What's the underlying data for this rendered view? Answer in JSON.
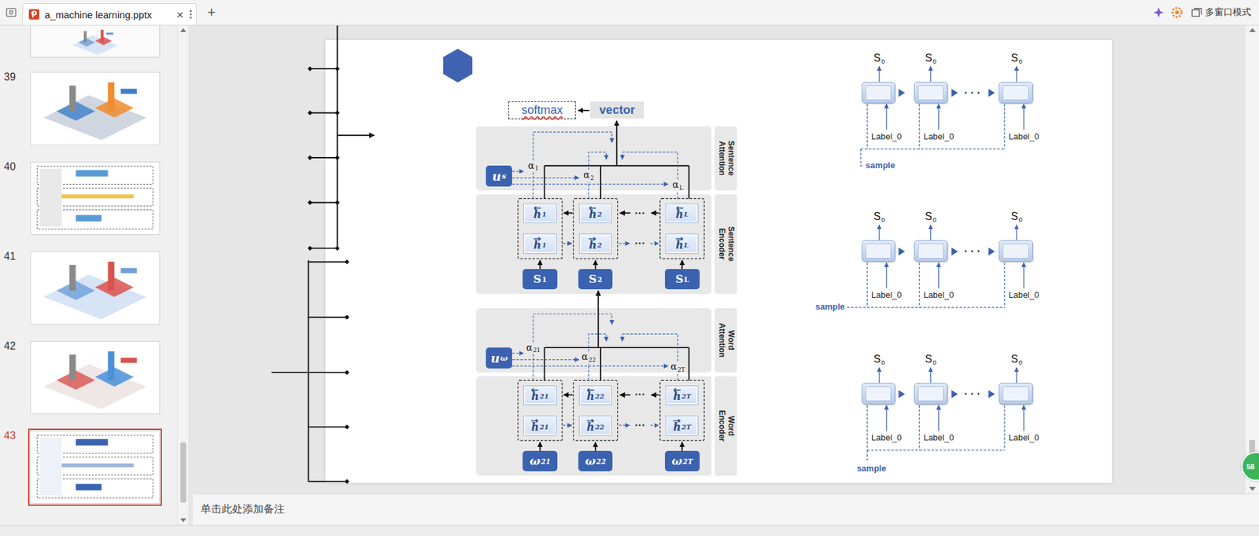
{
  "app": {
    "tab_title": "a_machine learning.pptx",
    "tab_close": "×",
    "new_tab": "+",
    "multi_window": "多窗口模式",
    "page_badge": "58"
  },
  "thumbnails": [
    {
      "number": "39",
      "selected": false
    },
    {
      "number": "40",
      "selected": false
    },
    {
      "number": "41",
      "selected": false
    },
    {
      "number": "42",
      "selected": false
    },
    {
      "number": "43",
      "selected": true
    }
  ],
  "notes": {
    "placeholder": "单击此处添加备注"
  },
  "han": {
    "softmax": {
      "text": "softmax",
      "misspelled": true
    },
    "vector": "vector",
    "levels": [
      {
        "attention_label": "Sentence Attention",
        "encoder_label": "Sentence Encoder",
        "context": {
          "base": "u",
          "sub": "s"
        },
        "ellipsis": "···",
        "alphas": [
          {
            "base": "α",
            "sub": "1"
          },
          {
            "base": "α",
            "sub": "2"
          },
          {
            "base": "α",
            "sub": "L"
          }
        ],
        "cells": [
          {
            "backward": {
              "base": "h",
              "sub": "1"
            },
            "forward": {
              "base": "h",
              "sub": "1"
            },
            "input": {
              "base": "S",
              "sub": "1"
            }
          },
          {
            "backward": {
              "base": "h",
              "sub": "2"
            },
            "forward": {
              "base": "h",
              "sub": "2"
            },
            "input": {
              "base": "S",
              "sub": "2"
            }
          },
          {
            "backward": {
              "base": "h",
              "sub": "L"
            },
            "forward": {
              "base": "h",
              "sub": "L"
            },
            "input": {
              "base": "S",
              "sub": "L"
            }
          }
        ]
      },
      {
        "attention_label": "Word Attention",
        "encoder_label": "Word Encoder",
        "context": {
          "base": "u",
          "sub": "ω"
        },
        "ellipsis": "···",
        "alphas": [
          {
            "base": "α",
            "sub": "21"
          },
          {
            "base": "α",
            "sub": "22"
          },
          {
            "base": "α",
            "sub": "2T"
          }
        ],
        "cells": [
          {
            "backward": {
              "base": "h",
              "sub": "21"
            },
            "forward": {
              "base": "h",
              "sub": "21"
            },
            "input": {
              "base": "ω",
              "sub": "21"
            }
          },
          {
            "backward": {
              "base": "h",
              "sub": "22"
            },
            "forward": {
              "base": "h",
              "sub": "22"
            },
            "input": {
              "base": "ω",
              "sub": "22"
            }
          },
          {
            "backward": {
              "base": "h",
              "sub": "2T"
            },
            "forward": {
              "base": "h",
              "sub": "2T"
            },
            "input": {
              "base": "ω",
              "sub": "2T"
            }
          }
        ]
      }
    ]
  },
  "decoders": [
    {
      "outputs": [
        {
          "base": "S",
          "sub": "0"
        },
        {
          "base": "S",
          "sub": "0"
        },
        {
          "base": "S",
          "sub": "0"
        }
      ],
      "labels": [
        "Label_0",
        "Label_0",
        "Label_0"
      ],
      "ellipsis": "· · ·",
      "sample": "sample"
    },
    {
      "outputs": [
        {
          "base": "S",
          "sub": "0"
        },
        {
          "base": "S",
          "sub": "0"
        },
        {
          "base": "S",
          "sub": "0"
        }
      ],
      "labels": [
        "Label_0",
        "Label_0",
        "Label_0"
      ],
      "ellipsis": "· · ·",
      "sample": "sample"
    },
    {
      "outputs": [
        {
          "base": "S",
          "sub": "0"
        },
        {
          "base": "S",
          "sub": "0"
        },
        {
          "base": "S",
          "sub": "0"
        }
      ],
      "labels": [
        "Label_0",
        "Label_0",
        "Label_0"
      ],
      "ellipsis": "· · ·",
      "sample": "sample"
    }
  ]
}
